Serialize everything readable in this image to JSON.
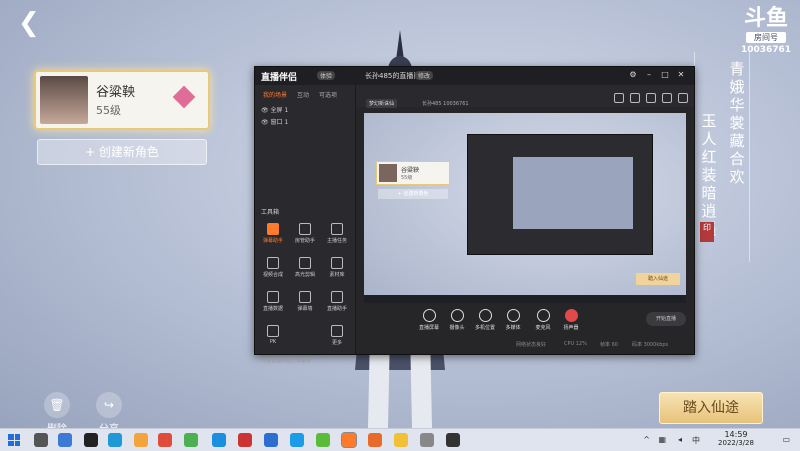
{
  "game": {
    "logo": {
      "mark": "斗鱼",
      "sub": "房间号",
      "room_number": "10036761"
    },
    "poem": {
      "col1": "青娥华裳藏合欢",
      "col2": "玉人红装暗逍遥"
    },
    "character": {
      "name": "谷粱鞅",
      "level": "55级"
    },
    "create_label": "+ 创建新角色",
    "delete_label": "删除",
    "share_label": "分享",
    "enter_label": "踏入仙途"
  },
  "app": {
    "logo": "直播伴侣",
    "version": "体验",
    "room_title": "长孙485的直播间",
    "room_tag": "修改",
    "tabs": [
      "我的场景",
      "互动",
      "可选项"
    ],
    "scenes": [
      "全屏 1",
      "窗口 1"
    ],
    "category_chip": "梦幻新诛仙",
    "room_id": "长孙485 10036761",
    "tools_title": "工具箱",
    "tools": [
      "弹幕助手",
      "房管助手",
      "主播任务",
      "视频合成",
      "高光剪辑",
      "素材库",
      "直播数据",
      "弹幕墙",
      "直播助手",
      "PK",
      "更多"
    ],
    "status_line": "斗鱼直播伴侣已准备好",
    "preview": {
      "character": {
        "name": "谷粱鞅",
        "level": "55级"
      },
      "create_label": "+ 创建新角色",
      "enter_label": "踏入仙途"
    },
    "controls": [
      "直播屏幕",
      "摄像头",
      "多机位置",
      "多媒体",
      "麦克风",
      "扬声器"
    ],
    "live_label": "开始直播",
    "stats": [
      "网络状态良好",
      "CPU 12%",
      "帧率 60",
      "码率 3000kbps"
    ]
  },
  "taskbar": {
    "time": "14:59",
    "date": "2022/3/28",
    "tray_label": "中"
  },
  "colors": {
    "accent_orange": "#ff7b2c",
    "gold": "#e8c979",
    "taskbar": "#dfe4ee"
  }
}
